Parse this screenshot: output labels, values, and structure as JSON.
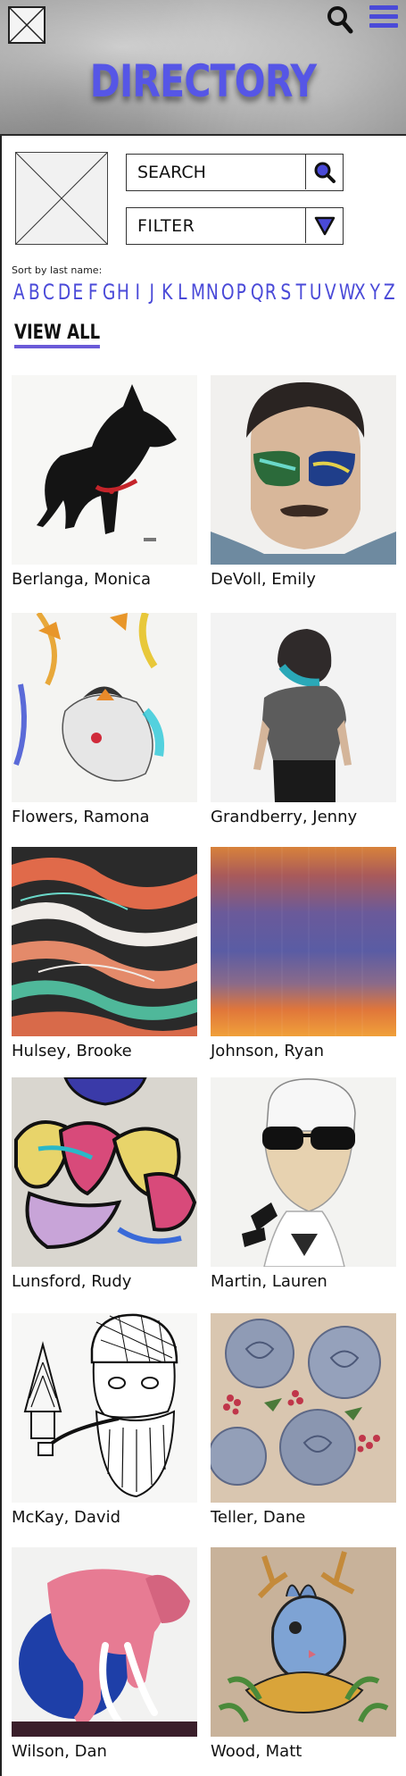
{
  "header": {
    "title": "DIRECTORY",
    "logo_icon": "logo-placeholder-icon",
    "search_icon": "search-icon",
    "menu_icon": "hamburger-menu-icon",
    "accent_color": "#5656e6"
  },
  "controls": {
    "search_placeholder": "SEARCH",
    "filter_label": "FILTER",
    "sort_label": "Sort by last name:",
    "letters": [
      "A",
      "B",
      "C",
      "D",
      "E",
      "F",
      "G",
      "H",
      "I",
      "J",
      "K",
      "L",
      "M",
      "N",
      "O",
      "P",
      "Q",
      "R",
      "S",
      "T",
      "U",
      "V",
      "W",
      "X",
      "Y",
      "Z"
    ],
    "view_all": "VIEW ALL"
  },
  "artists": [
    {
      "name": "Berlanga, Monica",
      "image": "dog-drawing"
    },
    {
      "name": "DeVoll, Emily",
      "image": "portrait-with-sunglasses"
    },
    {
      "name": "Flowers, Ramona",
      "image": "butterfly-watercolor"
    },
    {
      "name": "Grandberry, Jenny",
      "image": "teal-hair-figure"
    },
    {
      "name": "Hulsey, Brooke",
      "image": "marbled-abstract"
    },
    {
      "name": "Johnson, Ryan",
      "image": "color-gradient-field"
    },
    {
      "name": "Lunsford, Rudy",
      "image": "graffiti-lettering"
    },
    {
      "name": "Martin, Lauren",
      "image": "sunglasses-man-drawing"
    },
    {
      "name": "McKay, David",
      "image": "bearded-man-sketch"
    },
    {
      "name": "Teller, Dane",
      "image": "rose-stipple"
    },
    {
      "name": "Wilson, Dan",
      "image": "pink-elephant"
    },
    {
      "name": "Wood, Matt",
      "image": "rabbit-tattoo"
    }
  ]
}
